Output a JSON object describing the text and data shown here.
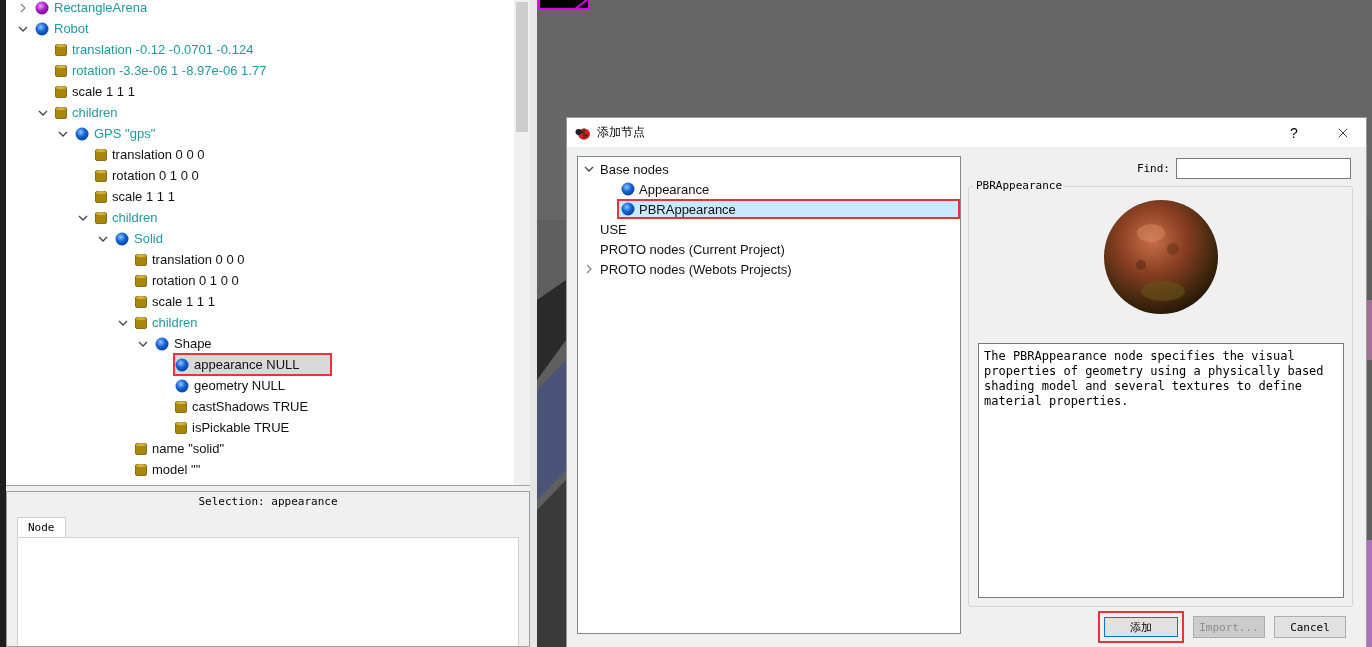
{
  "scene_tree": {
    "items": [
      {
        "label": "RectangleArena",
        "kind": "proto",
        "changed": true,
        "expanded": false,
        "selected": false,
        "marked": false
      },
      {
        "label": "Robot",
        "kind": "node",
        "changed": true,
        "expanded": true,
        "selected": false,
        "marked": false,
        "children": [
          {
            "label": "translation -0.12 -0.0701 -0.124",
            "kind": "field",
            "changed": true,
            "selected": false,
            "marked": false
          },
          {
            "label": "rotation -3.3e-06 1 -8.97e-06 1.77",
            "kind": "field",
            "changed": true,
            "selected": false,
            "marked": false
          },
          {
            "label": "scale 1 1 1",
            "kind": "field",
            "changed": false,
            "selected": false,
            "marked": false
          },
          {
            "label": "children",
            "kind": "field",
            "changed": true,
            "expanded": true,
            "selected": false,
            "marked": false,
            "children": [
              {
                "label": "GPS \"gps\"",
                "kind": "node",
                "changed": true,
                "expanded": true,
                "selected": false,
                "marked": false,
                "children": [
                  {
                    "label": "translation 0 0 0",
                    "kind": "field",
                    "changed": false,
                    "selected": false,
                    "marked": false
                  },
                  {
                    "label": "rotation 0 1 0 0",
                    "kind": "field",
                    "changed": false,
                    "selected": false,
                    "marked": false
                  },
                  {
                    "label": "scale 1 1 1",
                    "kind": "field",
                    "changed": false,
                    "selected": false,
                    "marked": false
                  },
                  {
                    "label": "children",
                    "kind": "field",
                    "changed": true,
                    "expanded": true,
                    "selected": false,
                    "marked": false,
                    "children": [
                      {
                        "label": "Solid",
                        "kind": "node",
                        "changed": true,
                        "expanded": true,
                        "selected": false,
                        "marked": false,
                        "children": [
                          {
                            "label": "translation 0 0 0",
                            "kind": "field",
                            "changed": false,
                            "selected": false,
                            "marked": false
                          },
                          {
                            "label": "rotation 0 1 0 0",
                            "kind": "field",
                            "changed": false,
                            "selected": false,
                            "marked": false
                          },
                          {
                            "label": "scale 1 1 1",
                            "kind": "field",
                            "changed": false,
                            "selected": false,
                            "marked": false
                          },
                          {
                            "label": "children",
                            "kind": "field",
                            "changed": true,
                            "expanded": true,
                            "selected": false,
                            "marked": false,
                            "children": [
                              {
                                "label": "Shape",
                                "kind": "node",
                                "changed": false,
                                "expanded": true,
                                "selected": false,
                                "marked": false,
                                "children": [
                                  {
                                    "label": "appearance NULL",
                                    "kind": "node",
                                    "changed": false,
                                    "selected": true,
                                    "marked": true
                                  },
                                  {
                                    "label": "geometry NULL",
                                    "kind": "node",
                                    "changed": false,
                                    "selected": false,
                                    "marked": false
                                  },
                                  {
                                    "label": "castShadows TRUE",
                                    "kind": "field",
                                    "changed": false,
                                    "selected": false,
                                    "marked": false
                                  },
                                  {
                                    "label": "isPickable TRUE",
                                    "kind": "field",
                                    "changed": false,
                                    "selected": false,
                                    "marked": false
                                  }
                                ]
                              }
                            ]
                          },
                          {
                            "label": "name \"solid\"",
                            "kind": "field",
                            "changed": false,
                            "selected": false,
                            "marked": false
                          },
                          {
                            "label": "model \"\"",
                            "kind": "field",
                            "changed": false,
                            "selected": false,
                            "marked": false
                          }
                        ]
                      }
                    ]
                  }
                ]
              }
            ]
          }
        ]
      }
    ]
  },
  "selection_label": "Selection: appearance",
  "properties_tabs": [
    {
      "label": "Node",
      "selected": true
    }
  ],
  "dialog": {
    "title": "添加节点",
    "help": "?",
    "tree": [
      {
        "label": "Base nodes",
        "expanded": true,
        "selected": false,
        "marked": false,
        "children": [
          {
            "label": "Appearance",
            "kind": "node",
            "selected": false,
            "marked": false
          },
          {
            "label": "PBRAppearance",
            "kind": "node",
            "selected": true,
            "marked": true
          }
        ]
      },
      {
        "label": "USE",
        "selected": false,
        "marked": false
      },
      {
        "label": "PROTO nodes (Current Project)",
        "selected": false,
        "marked": false
      },
      {
        "label": "PROTO nodes (Webots Projects)",
        "expanded": false,
        "selected": false,
        "marked": false
      }
    ],
    "find_label": "Find:",
    "preview_title": "PBRAppearance",
    "description": "The PBRAppearance node specifies the visual properties of geometry using a physically based shading model and several textures to define material properties.",
    "buttons": [
      {
        "label": "添加",
        "kind": "default",
        "disabled": false,
        "marked": true
      },
      {
        "label": "Import...",
        "kind": "normal",
        "disabled": true,
        "marked": false
      },
      {
        "label": "Cancel",
        "kind": "normal",
        "disabled": false,
        "marked": false
      }
    ]
  }
}
